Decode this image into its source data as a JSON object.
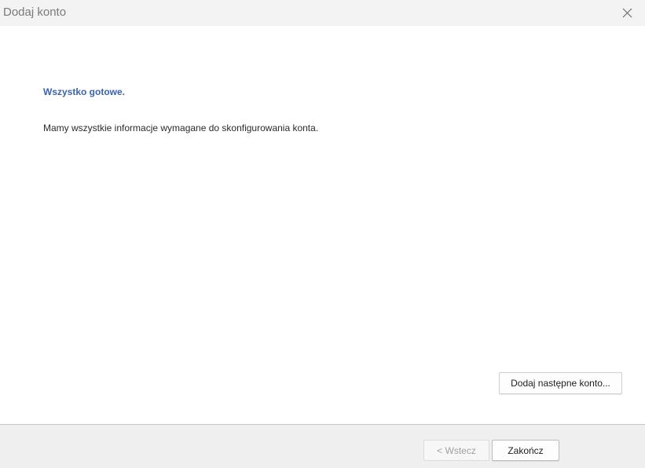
{
  "window": {
    "title": "Dodaj konto",
    "close_icon": "close-icon"
  },
  "main": {
    "heading": "Wszystko gotowe.",
    "info": "Mamy wszystkie informacje wymagane do skonfigurowania konta.",
    "add_another_label": "Dodaj następne konto..."
  },
  "footer": {
    "back_label": "< Wstecz",
    "back_enabled": false,
    "finish_label": "Zakończ"
  },
  "colors": {
    "heading": "#3a63ad",
    "titlebar": "#f3f3f3",
    "footer": "#efefef"
  }
}
